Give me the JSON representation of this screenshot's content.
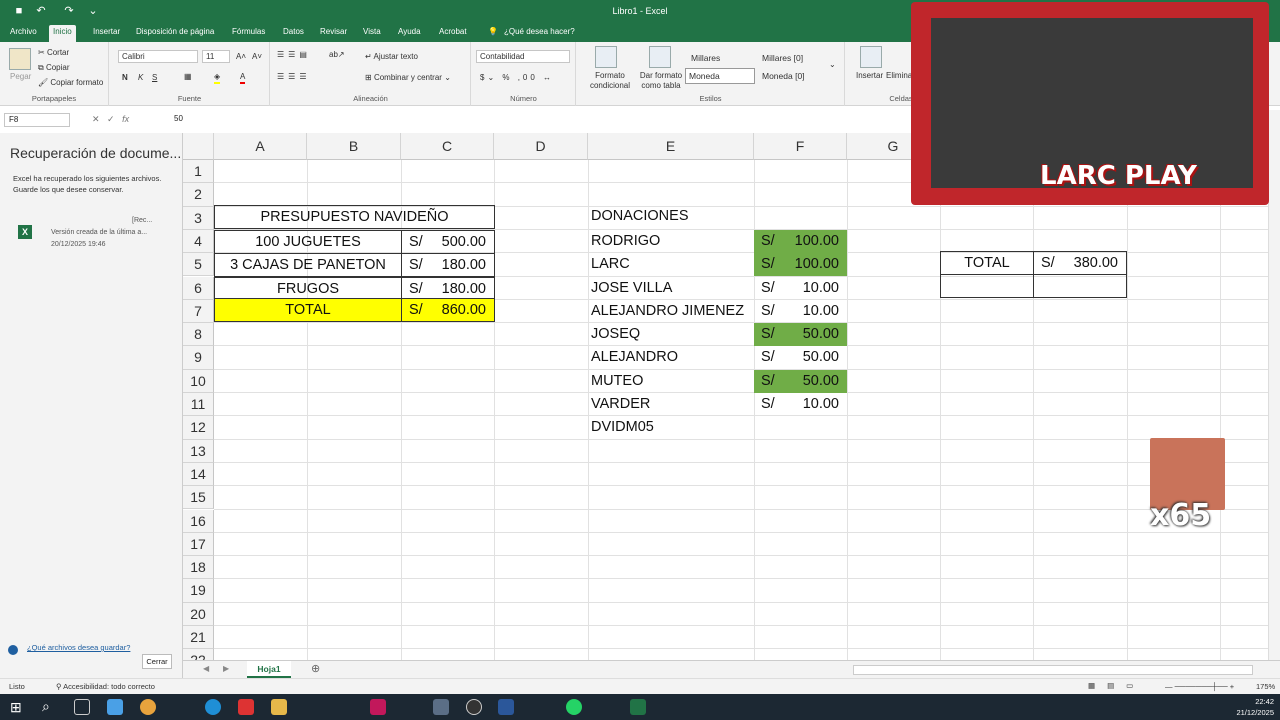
{
  "window": {
    "title": "Libro1 - Excel"
  },
  "ribbon_tabs": [
    "Archivo",
    "Inicio",
    "Insertar",
    "Disposición de página",
    "Fórmulas",
    "Datos",
    "Revisar",
    "Vista",
    "Ayuda",
    "Acrobat"
  ],
  "tell_me": "¿Qué desea hacer?",
  "ribbon": {
    "clipboard": {
      "paste": "Pegar",
      "cut": "Cortar",
      "copy": "Copiar",
      "format_painter": "Copiar formato",
      "label": "Portapapeles"
    },
    "font": {
      "name": "Calibri",
      "size": "11",
      "label": "Fuente",
      "bold": "N",
      "italic": "K",
      "underline": "S"
    },
    "alignment": {
      "wrap": "Ajustar texto",
      "merge": "Combinar y centrar",
      "label": "Alineación"
    },
    "number": {
      "format": "Contabilidad",
      "label": "Número"
    },
    "styles": {
      "conditional": "Formato condicional",
      "table": "Dar formato como tabla",
      "s1": "Millares",
      "s2": "Millares [0]",
      "s3": "Moneda",
      "s4": "Moneda [0]",
      "label": "Estilos"
    },
    "cells": {
      "insert": "Insertar",
      "delete": "Eliminar",
      "label": "Celdas"
    }
  },
  "formula_bar": {
    "name_box": "F8",
    "value": "50"
  },
  "recovery_pane": {
    "title": "Recuperación de docume...",
    "message": "Excel ha recuperado los siguientes archivos. Guarde los que desee conservar.",
    "file_name": "[Rec...",
    "file_desc": "Versión creada de la última a...",
    "file_date": "20/12/2025 19:46",
    "question_link": "¿Qué archivos desea guardar?",
    "close_button": "Cerrar"
  },
  "columns": [
    "A",
    "B",
    "C",
    "D",
    "E",
    "F",
    "G"
  ],
  "rows": [
    "1",
    "2",
    "3",
    "4",
    "5",
    "6",
    "7",
    "8",
    "9",
    "10",
    "11",
    "12",
    "13",
    "14",
    "15",
    "16",
    "17",
    "18",
    "19",
    "20",
    "21",
    "22"
  ],
  "budget": {
    "title": "PRESUPUESTO NAVIDEÑO",
    "currency": "S/",
    "items": [
      {
        "label": "100 JUGUETES",
        "amount": "500.00"
      },
      {
        "label": "3 CAJAS DE PANETON",
        "amount": "180.00"
      },
      {
        "label": "FRUGOS",
        "amount": "180.00"
      }
    ],
    "total_label": "TOTAL",
    "total_amount": "860.00"
  },
  "donations": {
    "title": "DONACIONES",
    "currency": "S/",
    "items": [
      {
        "name": "RODRIGO",
        "amount": "100.00",
        "highlight": true
      },
      {
        "name": "LARC",
        "amount": "100.00",
        "highlight": true
      },
      {
        "name": "JOSE VILLA",
        "amount": "10.00",
        "highlight": false
      },
      {
        "name": "ALEJANDRO JIMENEZ",
        "amount": "10.00",
        "highlight": false
      },
      {
        "name": "JOSEQ",
        "amount": "50.00",
        "highlight": true
      },
      {
        "name": "ALEJANDRO",
        "amount": "50.00",
        "highlight": false
      },
      {
        "name": "MUTEO",
        "amount": "50.00",
        "highlight": true
      },
      {
        "name": "VARDER",
        "amount": "10.00",
        "highlight": false
      },
      {
        "name": "DVIDM05",
        "amount": "",
        "highlight": false
      }
    ]
  },
  "donation_total": {
    "label": "TOTAL",
    "currency": "S/",
    "amount": "380.00"
  },
  "sheet_tab": "Hoja1",
  "status": {
    "ready": "Listo",
    "accessibility": "Accesibilidad: todo correcto",
    "zoom": "175%"
  },
  "taskbar": {
    "time": "22:42",
    "date": "21/12/2025"
  },
  "overlay": {
    "brand": "LARC PLAY",
    "counter": "x65"
  },
  "colors": {
    "excel_green": "#217346",
    "donation_highlight": "#70ad47",
    "total_highlight": "#ffff00"
  }
}
